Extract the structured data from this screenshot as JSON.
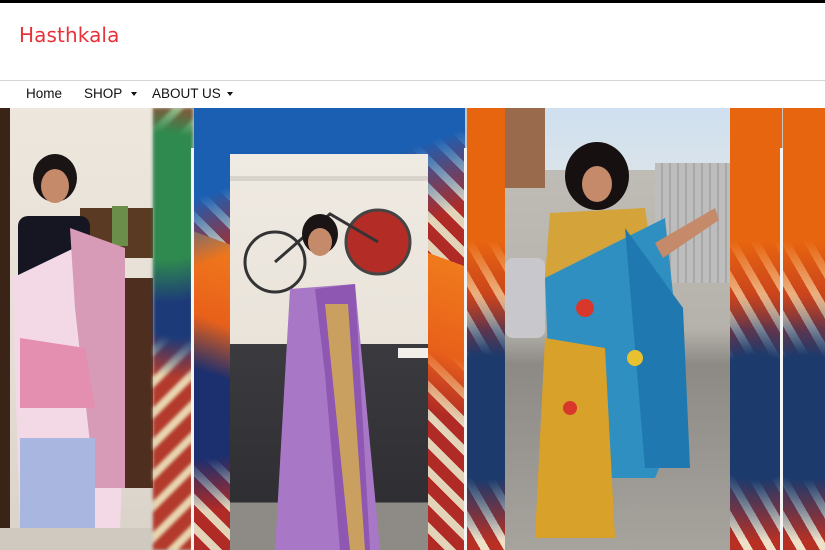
{
  "brand": {
    "name": "Hasthkala",
    "color": "#e8323a"
  },
  "nav": {
    "items": [
      {
        "label": "Home",
        "has_dropdown": false
      },
      {
        "label": "SHOP",
        "has_dropdown": true
      },
      {
        "label": "ABOUT US",
        "has_dropdown": true
      }
    ]
  },
  "banner": {
    "slides": [
      {
        "description": "model-in-white-pink-saree"
      },
      {
        "description": "model-in-lavender-saree"
      },
      {
        "description": "model-in-blue-yellow-kalamkari-saree"
      }
    ]
  }
}
